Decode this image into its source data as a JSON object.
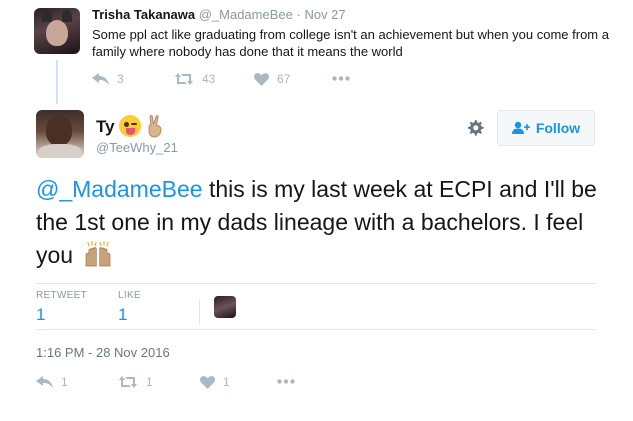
{
  "parent_tweet": {
    "name": "Trisha Takanawa",
    "handle": "@_MadameBee",
    "separator": "·",
    "date": "Nov 27",
    "text": "Some ppl act like graduating from college isn't an achievement but when you come from a family where nobody has done that it means the world",
    "actions": {
      "replies": "3",
      "retweets": "43",
      "likes": "67"
    }
  },
  "tweet": {
    "name": "Ty",
    "name_emojis": [
      "winking-tongue-emoji",
      "peace-sign-emoji"
    ],
    "handle": "@TeeWhy_21",
    "follow_label": "Follow",
    "mention": "@_MadameBee",
    "text": " this is my last week at ECPI and I'll be the 1st one in my dads lineage with a bachelors. I feel you",
    "stats": {
      "retweet_label": "RETWEET",
      "retweet_count": "1",
      "like_label": "LIKE",
      "like_count": "1"
    },
    "timestamp": "1:16 PM - 28 Nov 2016",
    "actions": {
      "replies": "1",
      "retweets": "1",
      "likes": "1"
    }
  },
  "icons": [
    "reply-icon",
    "retweet-icon",
    "heart-icon",
    "more-icon",
    "gear-icon",
    "follow-user-icon",
    "raised-hands-emoji"
  ],
  "colors": {
    "link": "#1b95e0",
    "muted": "#8899a6",
    "icon": "#aab8c2",
    "text": "#14171a",
    "thread": "#cce4f4"
  }
}
